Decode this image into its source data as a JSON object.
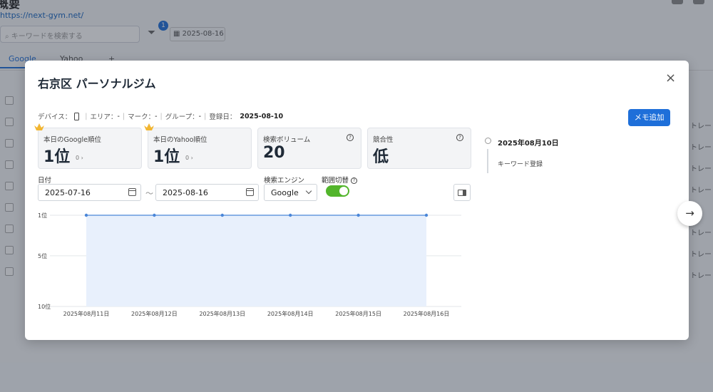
{
  "background": {
    "page_title": "概要",
    "url": "https://next-gym.net/",
    "search_placeholder": "キーワードを検索する",
    "filter_badge": "1",
    "date": "2025-08-16",
    "tabs": [
      "Google",
      "Yahoo",
      "+"
    ],
    "row_text": "トレー"
  },
  "modal": {
    "title": "右京区 パーソナルジム",
    "close": "×",
    "meta": {
      "device_label": "デバイス：",
      "area_label": "エリア：",
      "area_value": "-",
      "mark_label": "マーク：",
      "mark_value": "-",
      "group_label": "グループ：",
      "group_value": "-",
      "registered_label": "登録日：",
      "registered_value": "2025-08-10"
    },
    "memo_button": "メモ追加",
    "cards": [
      {
        "label": "本日のGoogle順位",
        "value": "1位",
        "sub": "0 ›"
      },
      {
        "label": "本日のYahoo順位",
        "value": "1位",
        "sub": "0 ›"
      },
      {
        "label": "検索ボリューム",
        "value": "20"
      },
      {
        "label": "競合性",
        "value": "低"
      }
    ],
    "filters": {
      "date_label": "日付",
      "date_from": "2025-07-16",
      "tilde": "〜",
      "date_to": "2025-08-16",
      "engine_label": "検索エンジン",
      "engine_value": "Google",
      "range_label": "範囲切替",
      "range_on": true
    },
    "timeline": {
      "date": "2025年08月10日",
      "event": "キーワード登録"
    }
  },
  "colors": {
    "accent": "#1e6fd9",
    "toggle_on": "#52b52b",
    "chart_fill": "#e8f0fc",
    "chart_line": "#4a86d8"
  },
  "chart_data": {
    "type": "area",
    "categories": [
      "2025年08月11日",
      "2025年08月12日",
      "2025年08月13日",
      "2025年08月14日",
      "2025年08月15日",
      "2025年08月16日"
    ],
    "values": [
      1,
      1,
      1,
      1,
      1,
      1
    ],
    "yticks": [
      "1位",
      "5位",
      "10位"
    ],
    "ylim": [
      1,
      10
    ],
    "y_inverted": true,
    "grid": true
  }
}
